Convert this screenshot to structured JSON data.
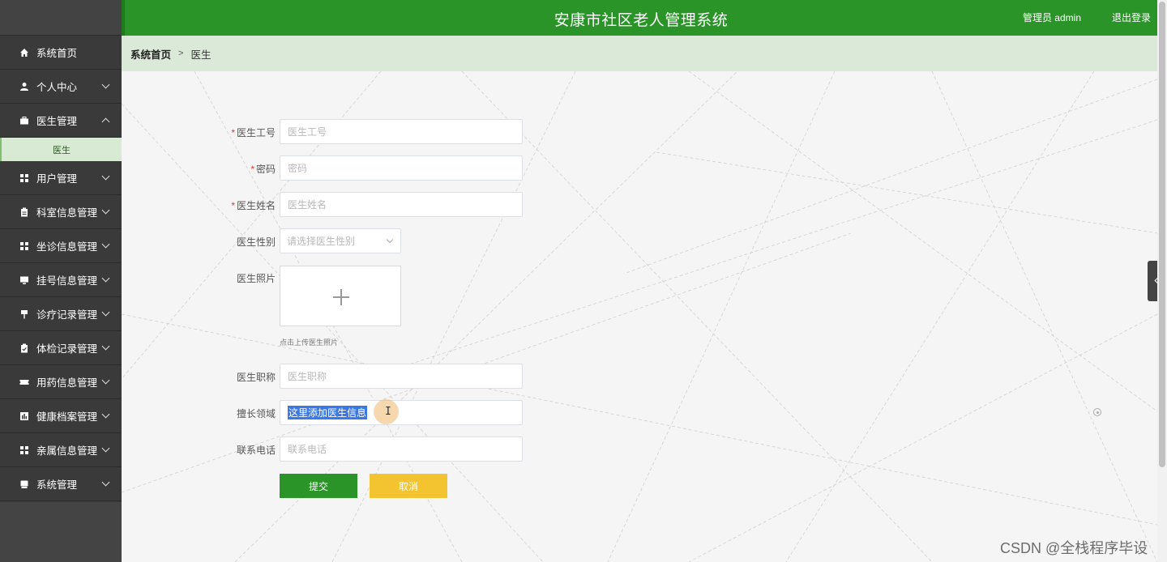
{
  "header": {
    "title": "安康市社区老人管理系统",
    "user": "管理员 admin",
    "logout": "退出登录"
  },
  "sidebar": {
    "items": [
      {
        "label": "系统首页",
        "icon": "home-icon"
      },
      {
        "label": "个人中心",
        "icon": "user-icon"
      },
      {
        "label": "医生管理",
        "icon": "briefcase-icon"
      },
      {
        "label": "用户管理",
        "icon": "grid-icon"
      },
      {
        "label": "科室信息管理",
        "icon": "clipboard-icon"
      },
      {
        "label": "坐诊信息管理",
        "icon": "grid-icon"
      },
      {
        "label": "挂号信息管理",
        "icon": "monitor-icon"
      },
      {
        "label": "诊疗记录管理",
        "icon": "pin-icon"
      },
      {
        "label": "体检记录管理",
        "icon": "clipboard-check-icon"
      },
      {
        "label": "用药信息管理",
        "icon": "ticket-icon"
      },
      {
        "label": "健康档案管理",
        "icon": "chart-icon"
      },
      {
        "label": "亲属信息管理",
        "icon": "grid-icon"
      },
      {
        "label": "系统管理",
        "icon": "drive-icon"
      }
    ],
    "sub_item": "医生"
  },
  "breadcrumb": {
    "home": "系统首页",
    "separator": ">",
    "current": "医生"
  },
  "form": {
    "doctor_id": {
      "label": "医生工号",
      "placeholder": "医生工号",
      "required": true
    },
    "password": {
      "label": "密码",
      "placeholder": "密码",
      "required": true
    },
    "doctor_name": {
      "label": "医生姓名",
      "placeholder": "医生姓名",
      "required": true
    },
    "gender": {
      "label": "医生性别",
      "placeholder": "请选择医生性别"
    },
    "photo": {
      "label": "医生照片",
      "tip": "点击上传医生照片"
    },
    "title": {
      "label": "医生职称",
      "placeholder": "医生职称"
    },
    "specialty": {
      "label": "擅长领域",
      "value": "这里添加医生信息"
    },
    "phone": {
      "label": "联系电话",
      "placeholder": "联系电话"
    },
    "submit": "提交",
    "cancel": "取消"
  },
  "required_mark": "*",
  "watermark": "CSDN @全栈程序毕设",
  "colors": {
    "header_green": "#2a9428",
    "sidebar_bg": "#3a3a3a",
    "breadcrumb_bg": "#dbe9d8",
    "cancel_yellow": "#f4c430"
  }
}
